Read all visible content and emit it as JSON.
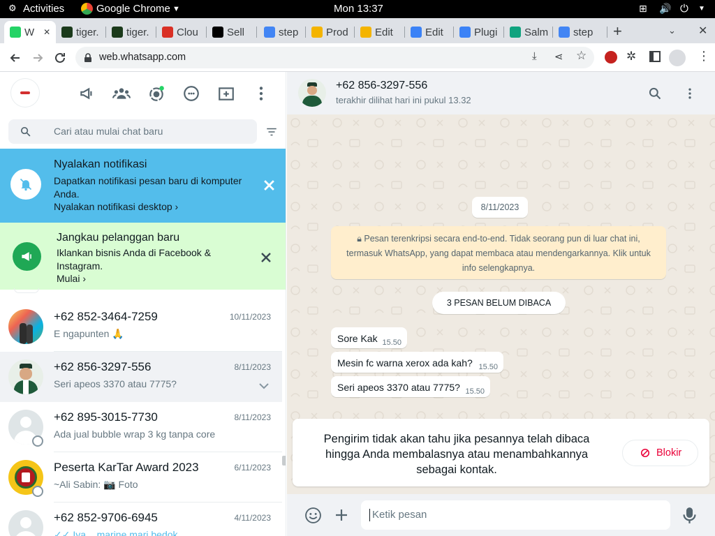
{
  "gnome": {
    "activities": "Activities",
    "app": "Google Chrome",
    "clock": "Mon 13:37"
  },
  "tabs": [
    {
      "label": "W",
      "color": "#25d366"
    },
    {
      "label": "tiger.",
      "color": "#1b3a1b"
    },
    {
      "label": "tiger.",
      "color": "#1b3a1b"
    },
    {
      "label": "Clou",
      "color": "#d93025"
    },
    {
      "label": "Sell",
      "color": "#000000"
    },
    {
      "label": "step",
      "color": "#4285f4"
    },
    {
      "label": "Prod",
      "color": "#f4b400"
    },
    {
      "label": "Edit",
      "color": "#f4b400"
    },
    {
      "label": "Edit",
      "color": "#3b82f6"
    },
    {
      "label": "Plugi",
      "color": "#3b82f6"
    },
    {
      "label": "Salm",
      "color": "#10a37f"
    },
    {
      "label": "step",
      "color": "#4285f4"
    }
  ],
  "browser": {
    "url": "web.whatsapp.com"
  },
  "sidebar": {
    "search_placeholder": "Cari atau mulai chat baru",
    "notification": {
      "title": "Nyalakan notifikasi",
      "body": "Dapatkan notifikasi pesan baru di komputer Anda.",
      "link": "Nyalakan notifikasi desktop"
    },
    "promo": {
      "title": "Jangkau pelanggan baru",
      "body": "Iklankan bisnis Anda di Facebook & Instagram.",
      "link": "Mulai"
    },
    "chats": [
      {
        "name": "+62 852-3464-7259",
        "date": "10/11/2023",
        "preview": "E ngapunten 🙏"
      },
      {
        "name": "+62 856-3297-556",
        "date": "8/11/2023",
        "preview": "Seri apeos 3370 atau 7775?"
      },
      {
        "name": "+62 895-3015-7730",
        "date": "8/11/2023",
        "preview": "Ada jual bubble wrap 3 kg tanpa core"
      },
      {
        "name": "Peserta KarTar Award 2023",
        "date": "6/11/2023",
        "preview": "~Ali Sabin: 📷 Foto"
      },
      {
        "name": "+62 852-9706-6945",
        "date": "4/11/2023",
        "preview": "✓✓ Iya... marine mari bedok"
      }
    ]
  },
  "conversation": {
    "contact": "+62 856-3297-556",
    "status": "terakhir dilihat hari ini pukul 13.32",
    "date_chip": "8/11/2023",
    "encryption_note": "Pesan terenkripsi secara end-to-end. Tidak seorang pun di luar chat ini, termasuk WhatsApp, yang dapat membaca atau mendengarkannya. Klik untuk info selengkapnya.",
    "unread_chip": "3 PESAN BELUM DIBACA",
    "messages": [
      {
        "text": "Sore Kak",
        "time": "15.50"
      },
      {
        "text": "Mesin fc warna xerox ada kah?",
        "time": "15.50"
      },
      {
        "text": "Seri apeos 3370 atau 7775?",
        "time": "15.50"
      }
    ],
    "unknown_notice": "Pengirim tidak akan tahu jika pesannya telah dibaca hingga Anda membalasnya atau menambahkannya sebagai kontak.",
    "block_label": "Blokir",
    "compose_placeholder": "Ketik pesan"
  },
  "colors": {
    "accent_blue": "#53bdeb",
    "accent_green": "#25d366",
    "promo_bg": "#d9fdd3",
    "danger": "#ea0038"
  },
  "icons": [
    "megaphone-icon",
    "communities-icon",
    "status-icon",
    "channels-icon",
    "new-chat-icon",
    "menu-icon",
    "search-icon",
    "filter-icon",
    "bell-off-icon",
    "close-icon",
    "emoji-icon",
    "plus-icon",
    "mic-icon",
    "block-icon"
  ]
}
